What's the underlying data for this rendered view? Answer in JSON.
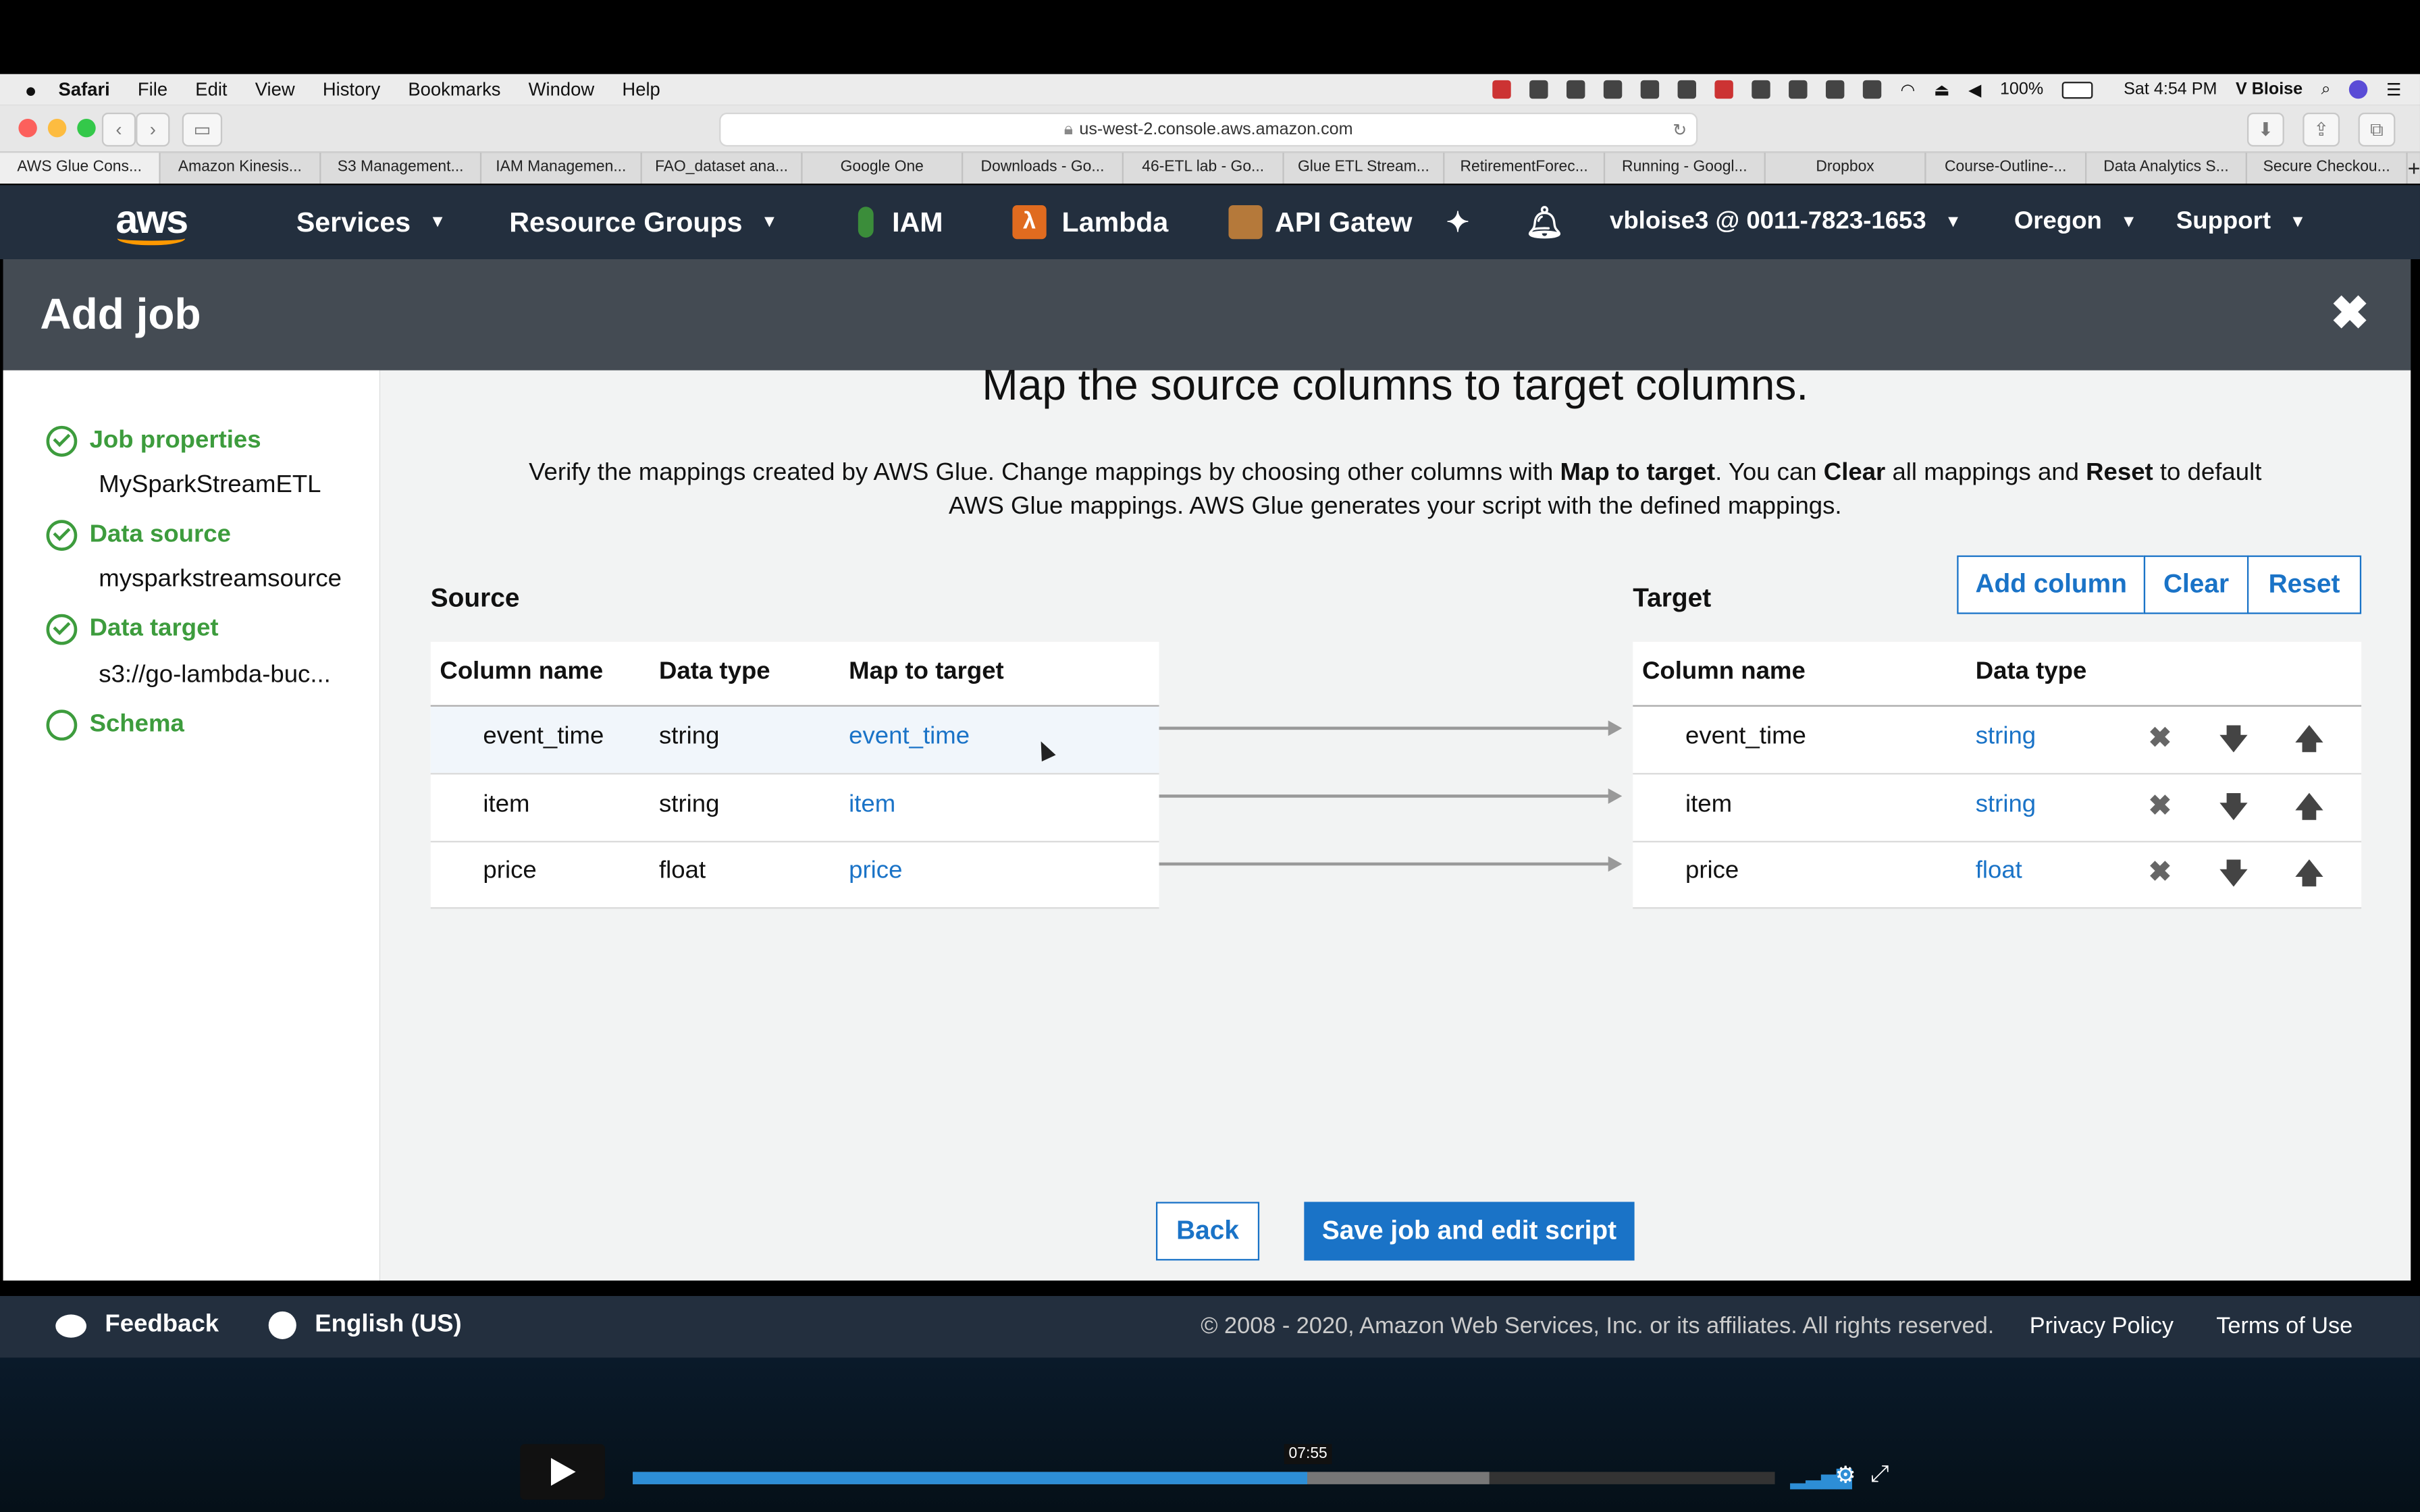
{
  "menubar": {
    "items": [
      "Safari",
      "File",
      "Edit",
      "View",
      "History",
      "Bookmarks",
      "Window",
      "Help"
    ],
    "battery": "100%",
    "clock": "Sat 4:54 PM",
    "user": "V Bloise"
  },
  "browser": {
    "url": "us-west-2.console.aws.amazon.com",
    "tabs": [
      "AWS Glue Cons...",
      "Amazon Kinesis...",
      "S3 Management...",
      "IAM Managemen...",
      "FAO_dataset ana...",
      "Google One",
      "Downloads - Go...",
      "46-ETL lab - Go...",
      "Glue ETL Stream...",
      "RetirementForec...",
      "Running - Googl...",
      "Dropbox",
      "Course-Outline-...",
      "Data Analytics S...",
      "Secure Checkou..."
    ]
  },
  "awsnav": {
    "logo": "aws",
    "services": "Services",
    "resource_groups": "Resource Groups",
    "iam": "IAM",
    "lambda": "Lambda",
    "api_gateway": "API Gatew",
    "account": "vbloise3 @ 0011-7823-1653",
    "region": "Oregon",
    "support": "Support"
  },
  "header": {
    "title": "Add job",
    "close": "✖"
  },
  "sidebar": {
    "steps": [
      {
        "label": "Job properties",
        "value": "MySparkStreamETL",
        "done": true
      },
      {
        "label": "Data source",
        "value": "mysparkstreamsource",
        "done": true
      },
      {
        "label": "Data target",
        "value": "s3://go-lambda-buc...",
        "done": true
      },
      {
        "label": "Schema",
        "value": "",
        "done": false
      }
    ]
  },
  "main": {
    "heading": "Map the source columns to target columns.",
    "desc_1": "Verify the mappings created by AWS Glue. Change mappings by choosing other columns with ",
    "desc_b1": "Map to target",
    "desc_2": ". You can ",
    "desc_b2": "Clear",
    "desc_3": " all mappings and ",
    "desc_b3": "Reset",
    "desc_4": " to default",
    "desc_line2": "AWS Glue mappings. AWS Glue generates your script with the defined mappings.",
    "source_label": "Source",
    "target_label": "Target",
    "buttons": {
      "add_column": "Add column",
      "clear": "Clear",
      "reset": "Reset",
      "back": "Back",
      "save": "Save job and edit script"
    },
    "source_headers": [
      "Column name",
      "Data type",
      "Map to target"
    ],
    "target_headers": [
      "Column name",
      "Data type"
    ],
    "source_rows": [
      {
        "name": "event_time",
        "type": "string",
        "map": "event_time"
      },
      {
        "name": "item",
        "type": "string",
        "map": "item"
      },
      {
        "name": "price",
        "type": "float",
        "map": "price"
      }
    ],
    "target_rows": [
      {
        "name": "event_time",
        "type": "string"
      },
      {
        "name": "item",
        "type": "string"
      },
      {
        "name": "price",
        "type": "float"
      }
    ]
  },
  "footer": {
    "feedback": "Feedback",
    "language": "English (US)",
    "copyright": "© 2008 - 2020, Amazon Web Services, Inc. or its affiliates. All rights reserved.",
    "privacy": "Privacy Policy",
    "terms": "Terms of Use"
  },
  "video": {
    "timestamp": "07:55",
    "progress": 0.59
  }
}
